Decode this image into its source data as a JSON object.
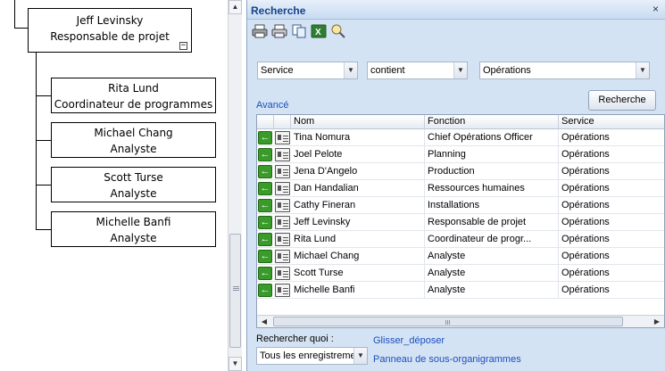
{
  "org_chart": {
    "root": {
      "name": "Jeff Levinsky",
      "title": "Responsable de projet",
      "collapse_symbol": "−"
    },
    "children": [
      {
        "name": "Rita Lund",
        "title": "Coordinateur de programmes"
      },
      {
        "name": "Michael Chang",
        "title": "Analyste"
      },
      {
        "name": "Scott Turse",
        "title": "Analyste"
      },
      {
        "name": "Michelle Banfi",
        "title": "Analyste"
      }
    ]
  },
  "search_pane": {
    "title": "Recherche",
    "close_symbol": "×",
    "toolbar": [
      "print-icon",
      "print-preview-icon",
      "copy-icon",
      "excel-export-icon",
      "search-settings-icon"
    ],
    "field_select": "Service",
    "operator_select": "contient",
    "value_select": "Opérations",
    "advanced_link": "Avancé",
    "search_button": "Recherche",
    "columns": [
      "Nom",
      "Fonction",
      "Service"
    ],
    "rows": [
      {
        "nom": "Tina Nomura",
        "fonction": "Chief Opérations Officer",
        "service": "Opérations"
      },
      {
        "nom": "Joel Pelote",
        "fonction": "Planning",
        "service": "Opérations"
      },
      {
        "nom": "Jena D'Angelo",
        "fonction": "Production",
        "service": "Opérations"
      },
      {
        "nom": "Dan Handalian",
        "fonction": "Ressources humaines",
        "service": "Opérations"
      },
      {
        "nom": "Cathy Fineran",
        "fonction": "Installations",
        "service": "Opérations"
      },
      {
        "nom": "Jeff Levinsky",
        "fonction": "Responsable de projet",
        "service": "Opérations"
      },
      {
        "nom": "Rita Lund",
        "fonction": "Coordinateur de progr...",
        "service": "Opérations"
      },
      {
        "nom": "Michael Chang",
        "fonction": "Analyste",
        "service": "Opérations"
      },
      {
        "nom": "Scott Turse",
        "fonction": "Analyste",
        "service": "Opérations"
      },
      {
        "nom": "Michelle Banfi",
        "fonction": "Analyste",
        "service": "Opérations"
      }
    ],
    "search_what_label": "Rechercher quoi :",
    "search_what_select": "Tous les enregistrements",
    "drag_drop_link": "Glisser_déposer",
    "subchart_link": "Panneau de sous-organigrammes"
  },
  "colors": {
    "pane_background": "#d4e3f4",
    "header_text": "#15428b",
    "link": "#1b4fbd",
    "add_icon": "#3a9b2a"
  }
}
